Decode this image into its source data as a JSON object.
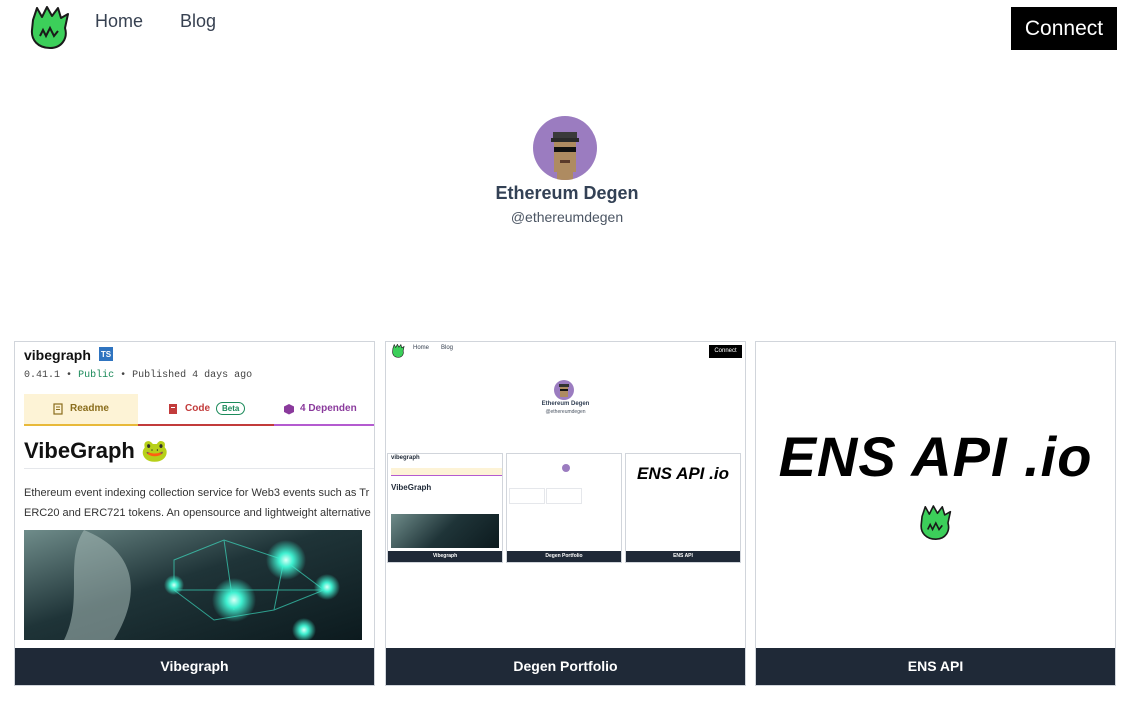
{
  "nav": {
    "logo_icon": "green-flame-logo-icon",
    "links": [
      {
        "label": "Home"
      },
      {
        "label": "Blog"
      }
    ],
    "connect_label": "Connect"
  },
  "profile": {
    "avatar_icon": "cryptopunk-avatar-icon",
    "name": "Ethereum Degen",
    "handle": "@ethereumdegen"
  },
  "projects": [
    {
      "label": "Vibegraph",
      "preview": {
        "package_name": "vibegraph",
        "ts_badge": "TS",
        "version": "0.41.1",
        "visibility": "Public",
        "published": "Published 4 days ago",
        "separator": "•",
        "tabs": [
          {
            "label": "Readme"
          },
          {
            "label": "Code",
            "badge": "Beta"
          },
          {
            "label": "4 Dependen"
          }
        ],
        "title": "VibeGraph",
        "title_emoji": "🐸",
        "description_lines": [
          "Ethereum event indexing collection service for Web3 events such as Tr",
          "ERC20 and ERC721 tokens. An opensource and lightweight alternative"
        ]
      }
    },
    {
      "label": "Degen Portfolio",
      "preview": {
        "nav_links": [
          "Home",
          "Blog"
        ],
        "connect": "Connect",
        "name": "Ethereum Degen",
        "handle": "@ethereumdegen",
        "cards": [
          "Vibegraph",
          "Degen Portfolio",
          "ENS API"
        ],
        "mini_pkg": "vibegraph",
        "mini_title": "VibeGraph",
        "mini_ens": "ENS API .io"
      }
    },
    {
      "label": "ENS API",
      "preview": {
        "title": "ENS API .io",
        "logo_icon": "green-flame-logo-icon"
      }
    }
  ],
  "colors": {
    "logo_green": "#3ccf5a",
    "card_label_bg": "#1f2937",
    "connect_bg": "#000000",
    "avatar_bg": "#9b7cc0"
  }
}
